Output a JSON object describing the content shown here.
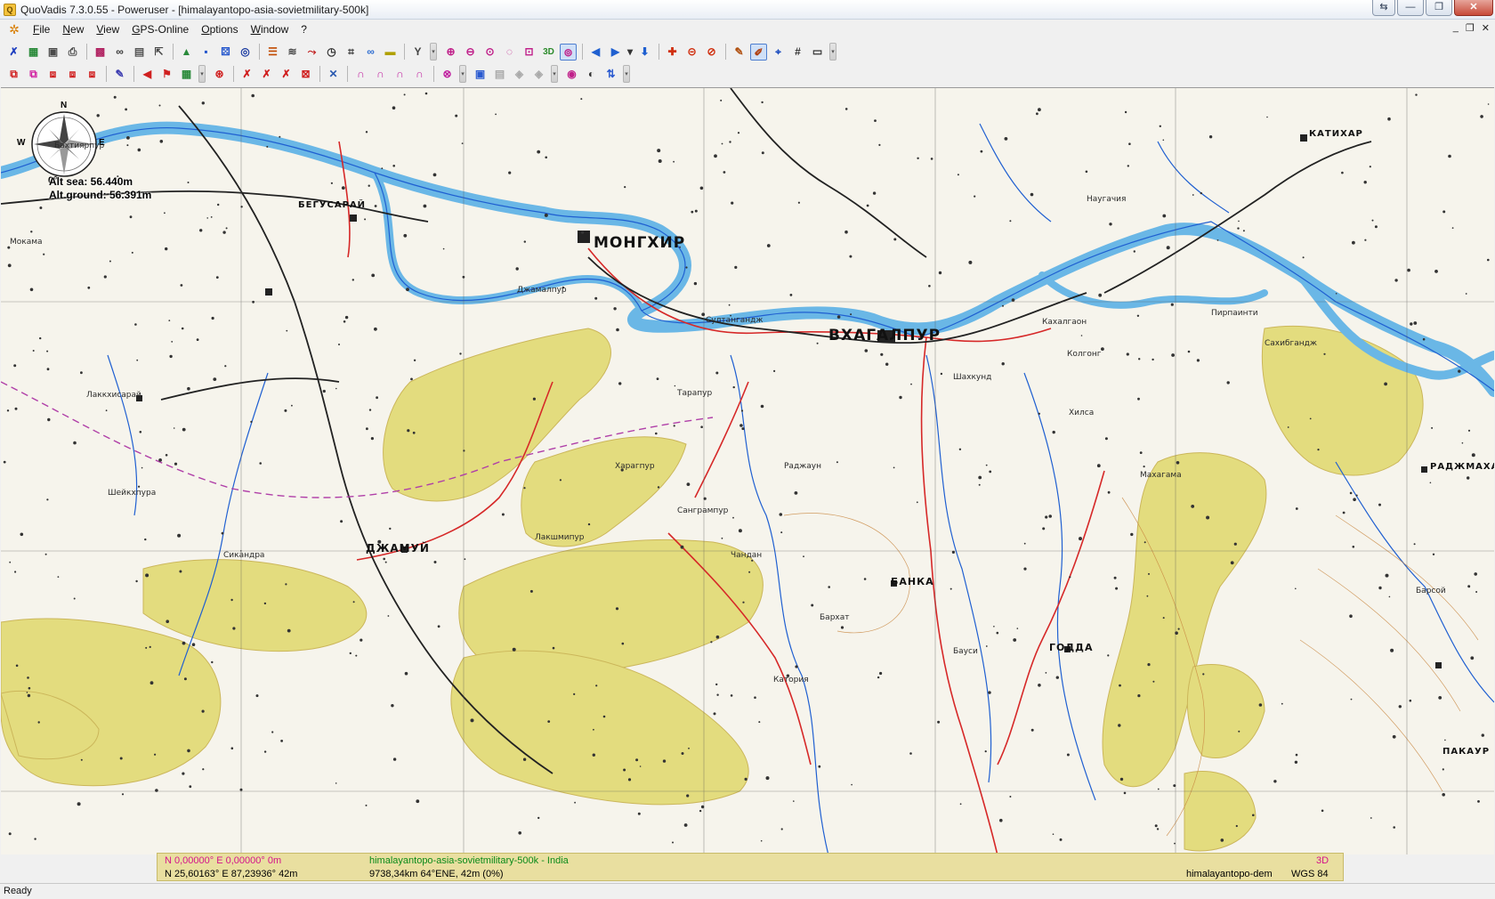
{
  "window": {
    "title": "QuoVadis 7.3.0.55 - Poweruser - [himalayantopo-asia-sovietmilitary-500k]"
  },
  "menu": {
    "items": [
      "File",
      "New",
      "View",
      "GPS-Online",
      "Options",
      "Window",
      "?"
    ]
  },
  "map": {
    "compass": {
      "n": "N",
      "e": "E",
      "w": "W",
      "heading": "0°"
    },
    "alt_sea": "Alt sea: 56.440m",
    "alt_ground": "Alt ground: 56.391m",
    "labels": {
      "mongkhir": "МОНГХИР",
      "bkhagalpur": "ВХАГАЛПУР",
      "dzhamui": "ДЖАМУЙ",
      "banka": "БАНКА",
      "godda": "ГОДДА",
      "begusarai": "БЕГУСАРАЙ",
      "katikhar": "КАТИХАР",
      "radzhmakhal": "РАДЖМАХАЛ",
      "pakaur": "ПАКАУР",
      "lakkhisarai": "Лаккхисарай",
      "sultanganj": "Султангандж",
      "bakhtiyarpur": "Бахтиярпур",
      "dzhamalpur": "Джамалпур",
      "tarapur": "Тарапур",
      "sheikhpura": "Шейкхпура",
      "kahalgaon": "Кахалгаон",
      "sahibganj": "Сахибгандж",
      "kolgong": "Колгонг",
      "shakhkund": "Шахкунд",
      "katoria": "Катория",
      "barhat": "Бархат",
      "bausi": "Бауси",
      "naugachia": "Наугачия",
      "kharagpur": "Харагпур",
      "sangrampur": "Сангрампур",
      "chandan": "Чандан",
      "lakshmipur": "Лакшмипур",
      "sikandra": "Сикандра",
      "barsoi": "Барсой",
      "hilsa": "Хилса",
      "mahagama": "Махагама",
      "pirpainti": "Пирпаинти",
      "mokama": "Мокама",
      "rajaun": "Раджаун"
    }
  },
  "map_status": {
    "coord_zero": "N 0,00000°  E 0,00000°  0m",
    "map_name": "himalayantopo-asia-sovietmilitary-500k - India",
    "mode_3d": "3D",
    "coord_cursor": "N 25,60163°  E 87,23936°  42m",
    "distance": "9738,34km 64°ENE,  42m (0%)",
    "dem_name": "himalayantopo-dem",
    "datum": "WGS 84"
  },
  "statusbar": {
    "text": "Ready"
  },
  "colors": {
    "water": "#6ab7e6",
    "river": "#1f5fd1",
    "road_red": "#d62828",
    "rail": "#222222",
    "hills": "#e3dc7e",
    "contour": "#c8863f",
    "status_overlay": "#e9dfa0",
    "coord_magenta": "#d4138a",
    "coord_green": "#0a8a19"
  }
}
